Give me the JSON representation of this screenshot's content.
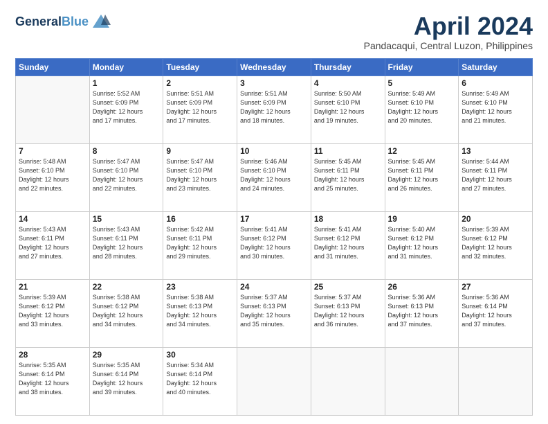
{
  "header": {
    "logo_line1": "General",
    "logo_line2": "Blue",
    "month_title": "April 2024",
    "location": "Pandacaqui, Central Luzon, Philippines"
  },
  "weekdays": [
    "Sunday",
    "Monday",
    "Tuesday",
    "Wednesday",
    "Thursday",
    "Friday",
    "Saturday"
  ],
  "weeks": [
    [
      {
        "day": "",
        "info": ""
      },
      {
        "day": "1",
        "info": "Sunrise: 5:52 AM\nSunset: 6:09 PM\nDaylight: 12 hours\nand 17 minutes."
      },
      {
        "day": "2",
        "info": "Sunrise: 5:51 AM\nSunset: 6:09 PM\nDaylight: 12 hours\nand 17 minutes."
      },
      {
        "day": "3",
        "info": "Sunrise: 5:51 AM\nSunset: 6:09 PM\nDaylight: 12 hours\nand 18 minutes."
      },
      {
        "day": "4",
        "info": "Sunrise: 5:50 AM\nSunset: 6:10 PM\nDaylight: 12 hours\nand 19 minutes."
      },
      {
        "day": "5",
        "info": "Sunrise: 5:49 AM\nSunset: 6:10 PM\nDaylight: 12 hours\nand 20 minutes."
      },
      {
        "day": "6",
        "info": "Sunrise: 5:49 AM\nSunset: 6:10 PM\nDaylight: 12 hours\nand 21 minutes."
      }
    ],
    [
      {
        "day": "7",
        "info": "Sunrise: 5:48 AM\nSunset: 6:10 PM\nDaylight: 12 hours\nand 22 minutes."
      },
      {
        "day": "8",
        "info": "Sunrise: 5:47 AM\nSunset: 6:10 PM\nDaylight: 12 hours\nand 22 minutes."
      },
      {
        "day": "9",
        "info": "Sunrise: 5:47 AM\nSunset: 6:10 PM\nDaylight: 12 hours\nand 23 minutes."
      },
      {
        "day": "10",
        "info": "Sunrise: 5:46 AM\nSunset: 6:10 PM\nDaylight: 12 hours\nand 24 minutes."
      },
      {
        "day": "11",
        "info": "Sunrise: 5:45 AM\nSunset: 6:11 PM\nDaylight: 12 hours\nand 25 minutes."
      },
      {
        "day": "12",
        "info": "Sunrise: 5:45 AM\nSunset: 6:11 PM\nDaylight: 12 hours\nand 26 minutes."
      },
      {
        "day": "13",
        "info": "Sunrise: 5:44 AM\nSunset: 6:11 PM\nDaylight: 12 hours\nand 27 minutes."
      }
    ],
    [
      {
        "day": "14",
        "info": "Sunrise: 5:43 AM\nSunset: 6:11 PM\nDaylight: 12 hours\nand 27 minutes."
      },
      {
        "day": "15",
        "info": "Sunrise: 5:43 AM\nSunset: 6:11 PM\nDaylight: 12 hours\nand 28 minutes."
      },
      {
        "day": "16",
        "info": "Sunrise: 5:42 AM\nSunset: 6:11 PM\nDaylight: 12 hours\nand 29 minutes."
      },
      {
        "day": "17",
        "info": "Sunrise: 5:41 AM\nSunset: 6:12 PM\nDaylight: 12 hours\nand 30 minutes."
      },
      {
        "day": "18",
        "info": "Sunrise: 5:41 AM\nSunset: 6:12 PM\nDaylight: 12 hours\nand 31 minutes."
      },
      {
        "day": "19",
        "info": "Sunrise: 5:40 AM\nSunset: 6:12 PM\nDaylight: 12 hours\nand 31 minutes."
      },
      {
        "day": "20",
        "info": "Sunrise: 5:39 AM\nSunset: 6:12 PM\nDaylight: 12 hours\nand 32 minutes."
      }
    ],
    [
      {
        "day": "21",
        "info": "Sunrise: 5:39 AM\nSunset: 6:12 PM\nDaylight: 12 hours\nand 33 minutes."
      },
      {
        "day": "22",
        "info": "Sunrise: 5:38 AM\nSunset: 6:12 PM\nDaylight: 12 hours\nand 34 minutes."
      },
      {
        "day": "23",
        "info": "Sunrise: 5:38 AM\nSunset: 6:13 PM\nDaylight: 12 hours\nand 34 minutes."
      },
      {
        "day": "24",
        "info": "Sunrise: 5:37 AM\nSunset: 6:13 PM\nDaylight: 12 hours\nand 35 minutes."
      },
      {
        "day": "25",
        "info": "Sunrise: 5:37 AM\nSunset: 6:13 PM\nDaylight: 12 hours\nand 36 minutes."
      },
      {
        "day": "26",
        "info": "Sunrise: 5:36 AM\nSunset: 6:13 PM\nDaylight: 12 hours\nand 37 minutes."
      },
      {
        "day": "27",
        "info": "Sunrise: 5:36 AM\nSunset: 6:14 PM\nDaylight: 12 hours\nand 37 minutes."
      }
    ],
    [
      {
        "day": "28",
        "info": "Sunrise: 5:35 AM\nSunset: 6:14 PM\nDaylight: 12 hours\nand 38 minutes."
      },
      {
        "day": "29",
        "info": "Sunrise: 5:35 AM\nSunset: 6:14 PM\nDaylight: 12 hours\nand 39 minutes."
      },
      {
        "day": "30",
        "info": "Sunrise: 5:34 AM\nSunset: 6:14 PM\nDaylight: 12 hours\nand 40 minutes."
      },
      {
        "day": "",
        "info": ""
      },
      {
        "day": "",
        "info": ""
      },
      {
        "day": "",
        "info": ""
      },
      {
        "day": "",
        "info": ""
      }
    ]
  ]
}
